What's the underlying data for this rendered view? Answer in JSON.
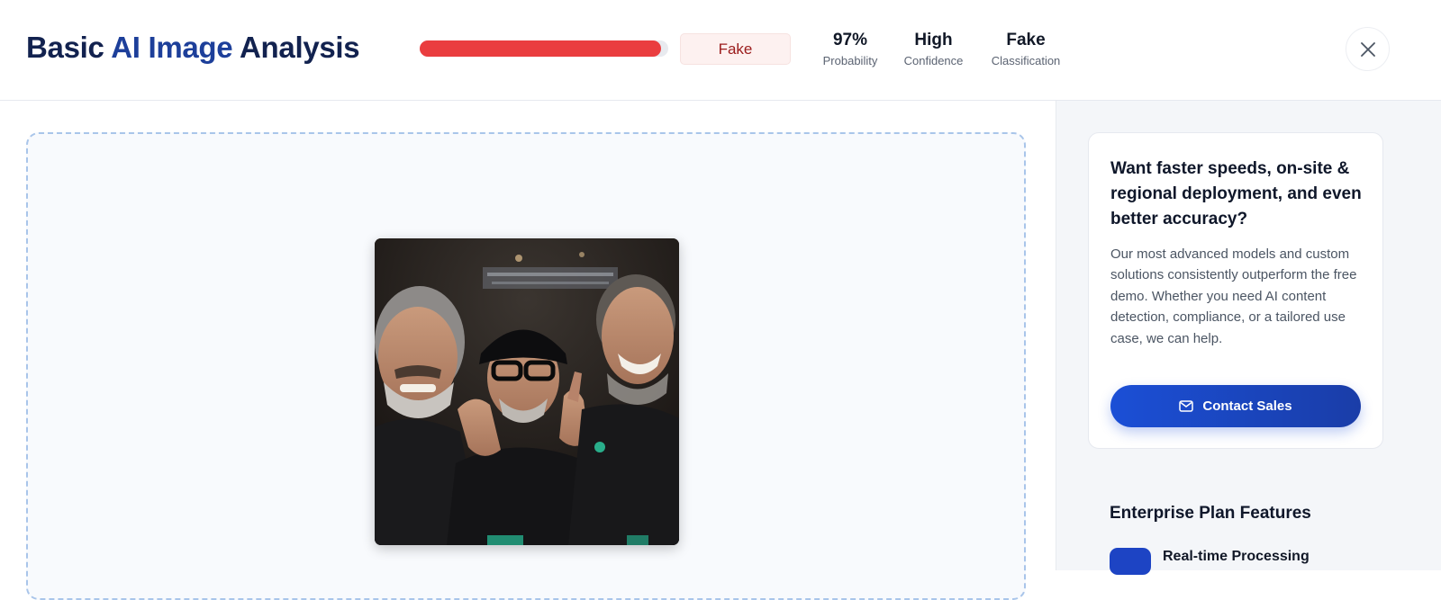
{
  "header": {
    "title_prefix": "Basic ",
    "title_ai": "AI Image",
    "title_suffix": " Analysis",
    "progress_fraction": 0.97,
    "verdict": "Fake",
    "stats": [
      {
        "value": "97%",
        "label": "Probability"
      },
      {
        "value": "High",
        "label": "Confidence"
      },
      {
        "value": "Fake",
        "label": "Classification"
      }
    ],
    "close_icon": "close-icon"
  },
  "colors": {
    "progress": "#ea3d3f",
    "title_dark": "#12224f",
    "title_accent": "#1d3f9a",
    "primary_button": "#1b4fd6"
  },
  "sidebar": {
    "promo_title": "Want faster speeds, on-site & regional deployment, and even better accuracy?",
    "promo_body": "Our most advanced models and custom solutions consistently outperform the free demo. Whether you need AI content detection, compliance, or a tailored use case, we can help.",
    "contact_label": "Contact Sales",
    "contact_icon": "mail-icon",
    "features_heading": "Enterprise Plan Features",
    "features": [
      {
        "label": "Real-time Processing",
        "icon": "bolt-icon"
      }
    ]
  }
}
